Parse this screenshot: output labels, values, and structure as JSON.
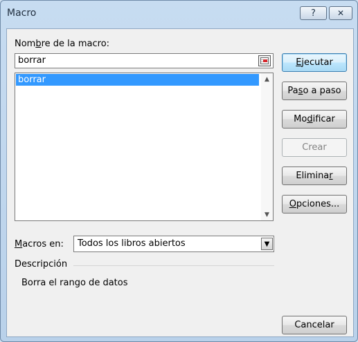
{
  "window": {
    "title": "Macro",
    "help_glyph": "?",
    "close_glyph": "✕"
  },
  "macro_name": {
    "label_pre": "Nom",
    "label_mn": "b",
    "label_post": "re de la macro:",
    "value": "borrar"
  },
  "macro_list": {
    "items": [
      "borrar"
    ],
    "selected": "borrar"
  },
  "buttons": {
    "run": {
      "pre": "",
      "mn": "E",
      "post": "jecutar"
    },
    "step": {
      "pre": "Pa",
      "mn": "s",
      "post": "o a paso"
    },
    "edit": {
      "pre": "Mo",
      "mn": "d",
      "post": "ificar"
    },
    "create": {
      "pre": "",
      "mn": "",
      "post": "Crear"
    },
    "delete": {
      "pre": "Elimina",
      "mn": "r",
      "post": ""
    },
    "options": {
      "pre": "",
      "mn": "O",
      "post": "pciones..."
    },
    "cancel": {
      "pre": "",
      "mn": "",
      "post": "Cancelar"
    }
  },
  "macros_in": {
    "label_pre": "",
    "label_mn": "M",
    "label_post": "acros en:",
    "selected": "Todos los libros abiertos"
  },
  "description": {
    "label": "Descripción",
    "text": "Borra el rango de datos"
  }
}
